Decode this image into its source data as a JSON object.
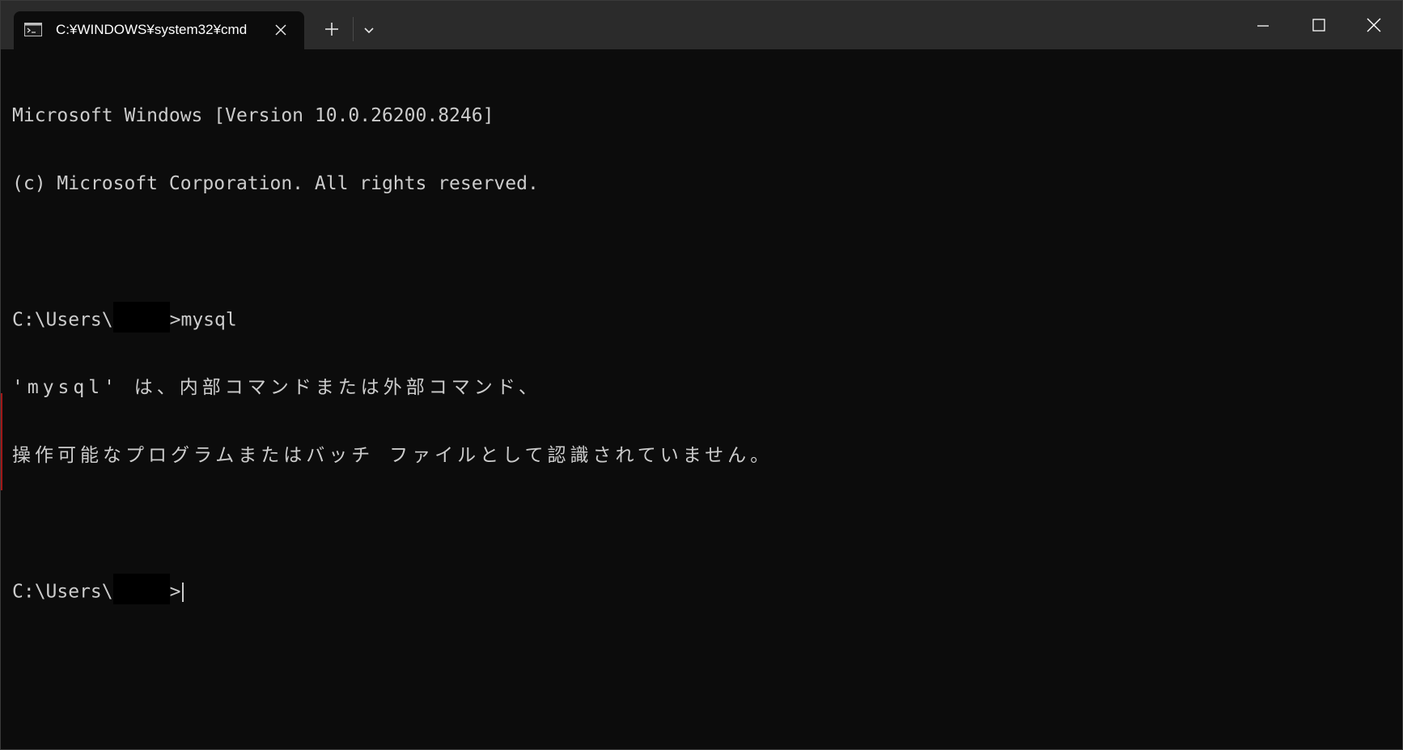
{
  "tab": {
    "title": "C:¥WINDOWS¥system32¥cmd",
    "icon": "console-icon"
  },
  "toolbar": {
    "new_tab_icon": "plus-icon",
    "dropdown_icon": "chevron-down-icon"
  },
  "window_controls": {
    "minimize_icon": "minimize-icon",
    "maximize_icon": "maximize-icon",
    "close_icon": "close-icon"
  },
  "terminal": {
    "lines": [
      "Microsoft Windows [Version 10.0.26200.8246]",
      "(c) Microsoft Corporation. All rights reserved.",
      "",
      "C:\\Users\\",
      ">mysql",
      "'mysql' は、内部コマンドまたは外部コマンド、",
      "操作可能なプログラムまたはバッチ ファイルとして認識されていません。",
      "",
      "C:\\Users\\",
      ">"
    ]
  },
  "colors": {
    "background": "#0c0c0c",
    "titlebar": "#2b2b2b",
    "text": "#cccccc"
  }
}
